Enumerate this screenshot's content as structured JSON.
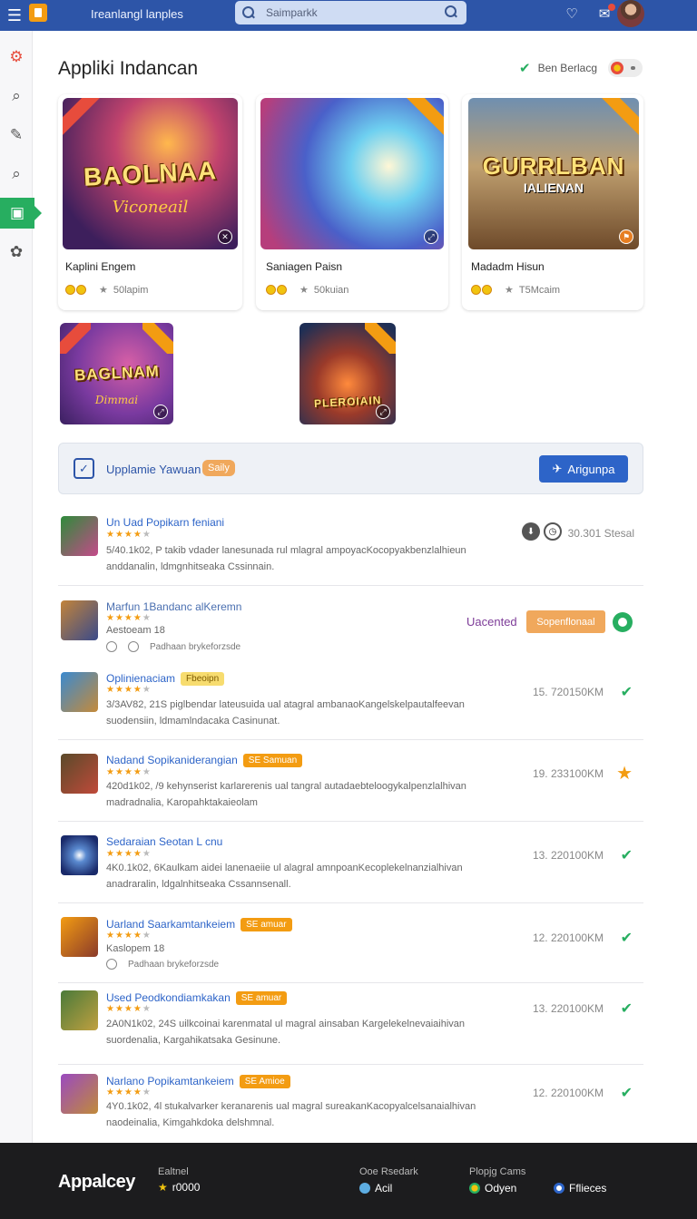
{
  "topbar": {
    "app_title": "Ireanlangl lanples",
    "search_placeholder": "Saimparkk",
    "colors": {
      "bar": "#2d55a8"
    }
  },
  "header": {
    "title": "Appliki Indancan",
    "status_text": "Ben Berlacg"
  },
  "featured": [
    {
      "art_title": "BAOLNAA",
      "art_sub": "Viconeail",
      "name": "Kaplini Engem",
      "meta": "50lapim"
    },
    {
      "art_title": "",
      "art_sub": "",
      "name": "Saniagen Paisn",
      "meta": "50kuian"
    },
    {
      "art_title": "GURRLBAN",
      "art_sub": "IALIENAN",
      "name": "Madadm Hisun",
      "meta": "T5Mcaim"
    },
    {
      "art_title": "BAGLNAM",
      "art_sub": "Dimmai",
      "name": "",
      "meta": ""
    },
    {
      "art_title": "PLEROIAIN",
      "art_sub": "",
      "name": "",
      "meta": ""
    }
  ],
  "banner": {
    "text": "Upplamie Yawuan",
    "badge": "Saily",
    "button": "Arigunpa"
  },
  "list": [
    {
      "title": "Un Uad Popikarn feniani",
      "tag": "",
      "desc1": "5/40.1k02, P takib vdader lanesunada rul mlagral ampoyacKocopyakbenzlalhieun",
      "desc2": "anddanalin,   ldmgnhitseaka Cssinnain.",
      "stat": "30.301 Stesal",
      "end": ""
    },
    {
      "title": "Marfun 1Bandanc alKeremn",
      "tag": "",
      "sub": "Aestoeam 18",
      "icons": "Padhaan brykeforzsde",
      "stat": "",
      "end": "",
      "action_text": "Uacented",
      "action_btn": "Sopenflonaal"
    },
    {
      "title": "Oplinienaciam",
      "tag": "Fbeoipn",
      "desc1": "3/3AV82, 21S piglbendar lateusuida ual atagral ambanaoKangelskelpautalfeevan",
      "desc2": "suodensiin,   ldmamlndacaka Casinunat.",
      "stat": "15. 720150KM",
      "end": "check"
    },
    {
      "title": "Nadand Sopikaniderangian",
      "tag": "SE Samuan",
      "desc1": "420d1k02, /9 kehynserist karlarerenis ual tangral autadaebteloogykalpenzlalhivan",
      "desc2": "madradnalia,   Karopahktakaieolam",
      "stat": "19. 233100KM",
      "end": "star"
    },
    {
      "title": "Sedaraian Seotan L cnu",
      "tag": "",
      "desc1": "4K0.1k02, 6Kaulkam aidei lanenaeiie ul alagral amnpoanKecoplekelnanzialhivan",
      "desc2": "anadraralin,   ldgalnhitseaka Cssannsenall.",
      "stat": "13. 220100KM",
      "end": "check"
    },
    {
      "title": "Uarland Saarkamtankeiem",
      "tag": "SE amuar",
      "sub": "Kaslopem 18",
      "icons": "Padhaan brykeforzsde",
      "stat": "12. 220100KM",
      "end": "check"
    },
    {
      "title": "Used Peodkondiamkakan",
      "tag": "SE amuar",
      "desc1": "2A0N1k02, 24S uilkcoinai karenmatal ul magral ainsaban Kargelekelnevaiaihivan",
      "desc2": "suordenalia,   Kargahikatsaka Gesinune.",
      "stat": "13. 220100KM",
      "end": "check"
    },
    {
      "title": "Narlano Popikamtankeiem",
      "tag": "SE Amioe",
      "desc1": "4Y0.1k02, 4l stukalvarker keranarenis ual magral sureakanKacopyalcelsanaialhivan",
      "desc2": "naodeinalia,   Kimgahkdoka delshmnal.",
      "stat": "12. 220100KM",
      "end": "check"
    }
  ],
  "footer": {
    "brand": "Appalcey",
    "col1_label": "Ealtnel",
    "col1_value": "r0000",
    "col2_label": "Ooe Rsedark",
    "col2_value": "Acil",
    "col3_label": "Plopjg Cams",
    "col3_value": "Odyen",
    "col4_value": "Fflieces"
  }
}
